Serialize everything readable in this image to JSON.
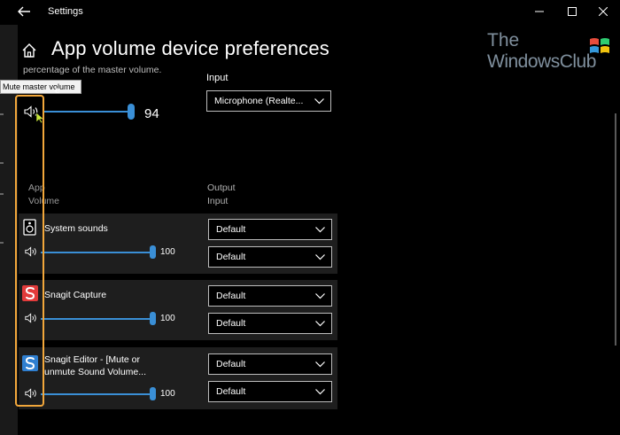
{
  "window": {
    "title": "Settings"
  },
  "page": {
    "title": "App volume  device preferences",
    "subtitle": "percentage of the master volume."
  },
  "tooltip": {
    "text": "Mute master volume",
    "partial_label": "e"
  },
  "master": {
    "volume": 94,
    "volume_label": "94"
  },
  "input": {
    "label": "Input",
    "device": "Microphone (Realte..."
  },
  "columns": {
    "app": "App",
    "volume": "Volume",
    "output": "Output",
    "input": "Input"
  },
  "apps": [
    {
      "name": "System sounds",
      "volume": 100,
      "volume_label": "100",
      "output": "Default",
      "input": "Default",
      "icon": "speaker-icon"
    },
    {
      "name": "Snagit Capture",
      "volume": 100,
      "volume_label": "100",
      "output": "Default",
      "input": "Default",
      "icon": "snagit-icon"
    },
    {
      "name_line1": "Snagit Editor - [Mute or",
      "name_line2": "unmute Sound Volume...",
      "volume": 100,
      "volume_label": "100",
      "output": "Default",
      "input": "Default",
      "icon": "snagit-editor-icon"
    }
  ],
  "logo": {
    "line1": "The",
    "line2": "WindowsClub"
  },
  "colors": {
    "accent": "#3a8fd6",
    "highlight": "#f2a73b",
    "background": "#000000",
    "row": "#1e1e1e"
  }
}
